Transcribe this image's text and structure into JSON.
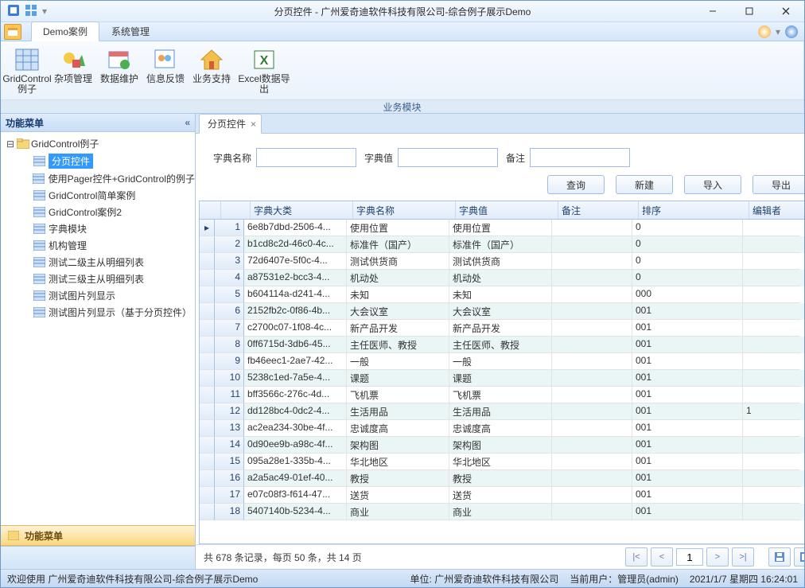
{
  "window": {
    "title": "分页控件 - 广州爱奇迪软件科技有限公司-综合例子展示Demo"
  },
  "menuTabs": {
    "active": "Demo案例",
    "other": "系统管理"
  },
  "ribbon": {
    "groupCaption": "业务模块",
    "items": [
      "GridControl例子",
      "杂项管理",
      "数据维护",
      "信息反馈",
      "业务支持",
      "Excel数据导出"
    ]
  },
  "sidebar": {
    "title": "功能菜单",
    "root": "GridControl例子",
    "items": [
      "分页控件",
      "使用Pager控件+GridControl的例子",
      "GridControl简单案例",
      "GridControl案例2",
      "字典模块",
      "机构管理",
      "测试二级主从明细列表",
      "测试三级主从明细列表",
      "测试图片列显示",
      "测试图片列显示（基于分页控件）"
    ],
    "accordion": "功能菜单"
  },
  "docTab": {
    "label": "分页控件"
  },
  "search": {
    "l1": "字典名称",
    "l2": "字典值",
    "l3": "备注"
  },
  "buttons": {
    "q": "查询",
    "n": "新建",
    "i": "导入",
    "e": "导出"
  },
  "grid": {
    "headers": [
      "字典大类",
      "字典名称",
      "字典值",
      "备注",
      "排序",
      "编辑者"
    ],
    "rows": [
      {
        "a": "6e8b7dbd-2506-4...",
        "b": "使用位置",
        "c": "使用位置",
        "d": "",
        "e": "0",
        "f": ""
      },
      {
        "a": "b1cd8c2d-46c0-4c...",
        "b": "标准件（国产）",
        "c": "标准件（国产）",
        "d": "",
        "e": "0",
        "f": ""
      },
      {
        "a": "72d6407e-5f0c-4...",
        "b": "测试供货商",
        "c": "测试供货商",
        "d": "",
        "e": "0",
        "f": ""
      },
      {
        "a": "a87531e2-bcc3-4...",
        "b": "机动处",
        "c": "机动处",
        "d": "",
        "e": "0",
        "f": ""
      },
      {
        "a": "b604114a-d241-4...",
        "b": "未知",
        "c": "未知",
        "d": "",
        "e": "000",
        "f": ""
      },
      {
        "a": "2152fb2c-0f86-4b...",
        "b": "大会议室",
        "c": "大会议室",
        "d": "",
        "e": "001",
        "f": ""
      },
      {
        "a": "c2700c07-1f08-4c...",
        "b": "新产品开发",
        "c": "新产品开发",
        "d": "",
        "e": "001",
        "f": ""
      },
      {
        "a": "0ff6715d-3db6-45...",
        "b": "主任医师、教授",
        "c": "主任医师、教授",
        "d": "",
        "e": "001",
        "f": ""
      },
      {
        "a": "fb46eec1-2ae7-42...",
        "b": "一般",
        "c": "一般",
        "d": "",
        "e": "001",
        "f": ""
      },
      {
        "a": "5238c1ed-7a5e-4...",
        "b": "课题",
        "c": "课题",
        "d": "",
        "e": "001",
        "f": ""
      },
      {
        "a": "bff3566c-276c-4d...",
        "b": "飞机票",
        "c": "飞机票",
        "d": "",
        "e": "001",
        "f": ""
      },
      {
        "a": "dd128bc4-0dc2-4...",
        "b": "生活用品",
        "c": "生活用品",
        "d": "",
        "e": "001",
        "f": "1"
      },
      {
        "a": "ac2ea234-30be-4f...",
        "b": "忠诚度高",
        "c": "忠诚度高",
        "d": "",
        "e": "001",
        "f": ""
      },
      {
        "a": "0d90ee9b-a98c-4f...",
        "b": "架构图",
        "c": "架构图",
        "d": "",
        "e": "001",
        "f": ""
      },
      {
        "a": "095a28e1-335b-4...",
        "b": "华北地区",
        "c": "华北地区",
        "d": "",
        "e": "001",
        "f": ""
      },
      {
        "a": "a2a5ac49-01ef-40...",
        "b": "教授",
        "c": "教授",
        "d": "",
        "e": "001",
        "f": ""
      },
      {
        "a": "e07c08f3-f614-47...",
        "b": "送货",
        "c": "送货",
        "d": "",
        "e": "001",
        "f": ""
      },
      {
        "a": "5407140b-5234-4...",
        "b": "商业",
        "c": "商业",
        "d": "",
        "e": "001",
        "f": ""
      }
    ]
  },
  "pager": {
    "info": "共 678 条记录，每页 50 条，共 14 页",
    "page": "1"
  },
  "status": {
    "welcome": "欢迎使用 广州爱奇迪软件科技有限公司-综合例子展示Demo",
    "unit": "单位: 广州爱奇迪软件科技有限公司",
    "user": "当前用户：管理员(admin)",
    "time": "2021/1/7 星期四 16:24:01"
  }
}
